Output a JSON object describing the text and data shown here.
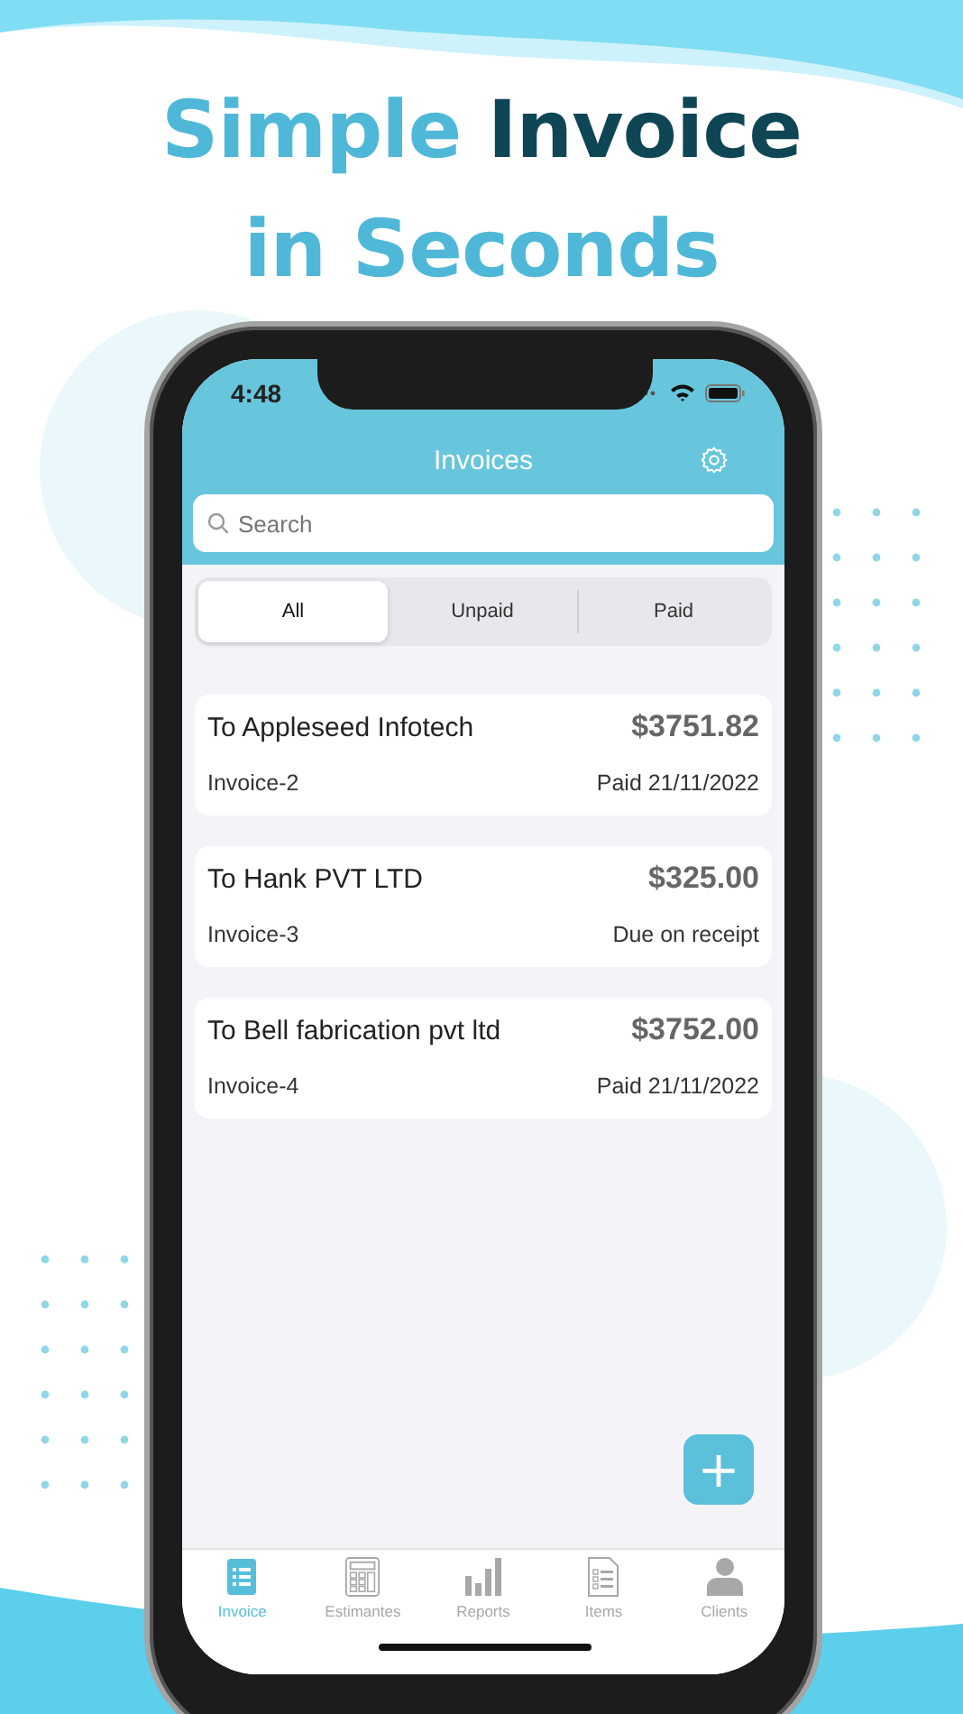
{
  "headline": [
    [
      {
        "text": "Simple",
        "color": "#4fb8d8"
      },
      {
        "text": "Invoice",
        "color": "#0f4656"
      }
    ],
    [
      {
        "text": "in Seconds",
        "color": "#4fb8d8"
      }
    ]
  ],
  "status_bar": {
    "time": "4:48"
  },
  "nav_bar": {
    "title": "Invoices"
  },
  "search": {
    "placeholder": "Search"
  },
  "filters": [
    {
      "label": "All",
      "selected": true
    },
    {
      "label": "Unpaid",
      "selected": false
    },
    {
      "label": "Paid",
      "selected": false
    }
  ],
  "invoices": [
    {
      "client": "To Appleseed Infotech",
      "amount": "$3751.82",
      "number": "Invoice-2",
      "status": "Paid 21/11/2022"
    },
    {
      "client": "To Hank PVT LTD",
      "amount": "$325.00",
      "number": "Invoice-3",
      "status": "Due on receipt"
    },
    {
      "client": "To Bell fabrication pvt ltd",
      "amount": "$3752.00",
      "number": "Invoice-4",
      "status": "Paid 21/11/2022"
    }
  ],
  "add_button": {
    "label": "+"
  },
  "tab_bar": [
    {
      "label": "Invoice",
      "kind": "invoice",
      "selected": true
    },
    {
      "label": "Estimantes",
      "kind": "calculator",
      "selected": false
    },
    {
      "label": "Reports",
      "kind": "chart",
      "selected": false
    },
    {
      "label": "Items",
      "kind": "document",
      "selected": false
    },
    {
      "label": "Clients",
      "kind": "person",
      "selected": false
    }
  ]
}
